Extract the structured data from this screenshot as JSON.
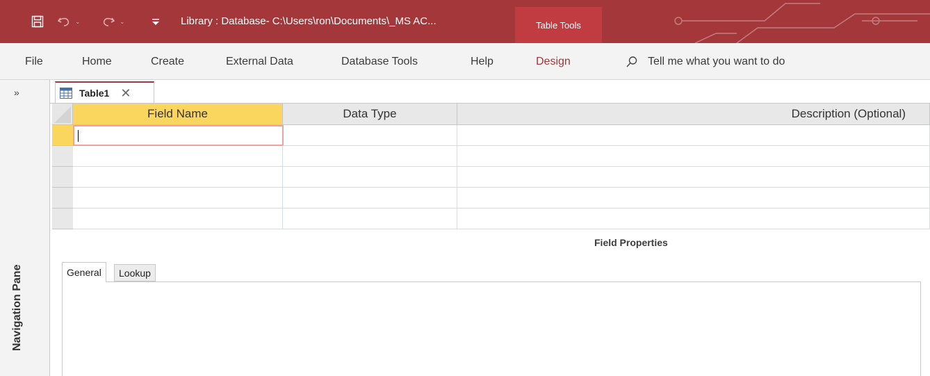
{
  "titlebar": {
    "title": "Library : Database- C:\\Users\\ron\\Documents\\_MS AC...",
    "context_tab": "Table Tools",
    "bg_color": "#a4373a",
    "qa_icons": [
      "save-icon",
      "undo-icon",
      "redo-icon",
      "customize-icon"
    ]
  },
  "ribbon": {
    "tabs": [
      {
        "label": "File"
      },
      {
        "label": "Home"
      },
      {
        "label": "Create"
      },
      {
        "label": "External Data"
      },
      {
        "label": "Database Tools"
      },
      {
        "label": "Help"
      },
      {
        "label": "Design",
        "active": true
      }
    ],
    "tell_me": "Tell me what you want to do",
    "active_color": "#a4373a"
  },
  "nav_pane": {
    "expand_glyph": "»",
    "label": "Navigation Pane"
  },
  "document": {
    "tab_label": "Table1"
  },
  "design_grid": {
    "headers": {
      "field_name": "Field Name",
      "data_type": "Data Type",
      "description": "Description (Optional)"
    },
    "row_count": 5,
    "rows": [
      {
        "field_name": "",
        "data_type": "",
        "description": ""
      },
      {
        "field_name": "",
        "data_type": "",
        "description": ""
      },
      {
        "field_name": "",
        "data_type": "",
        "description": ""
      },
      {
        "field_name": "",
        "data_type": "",
        "description": ""
      },
      {
        "field_name": "",
        "data_type": "",
        "description": ""
      }
    ],
    "current_color": "#fbd65f"
  },
  "field_properties": {
    "title": "Field Properties",
    "tabs": [
      {
        "label": "General",
        "active": true
      },
      {
        "label": "Lookup"
      }
    ]
  }
}
